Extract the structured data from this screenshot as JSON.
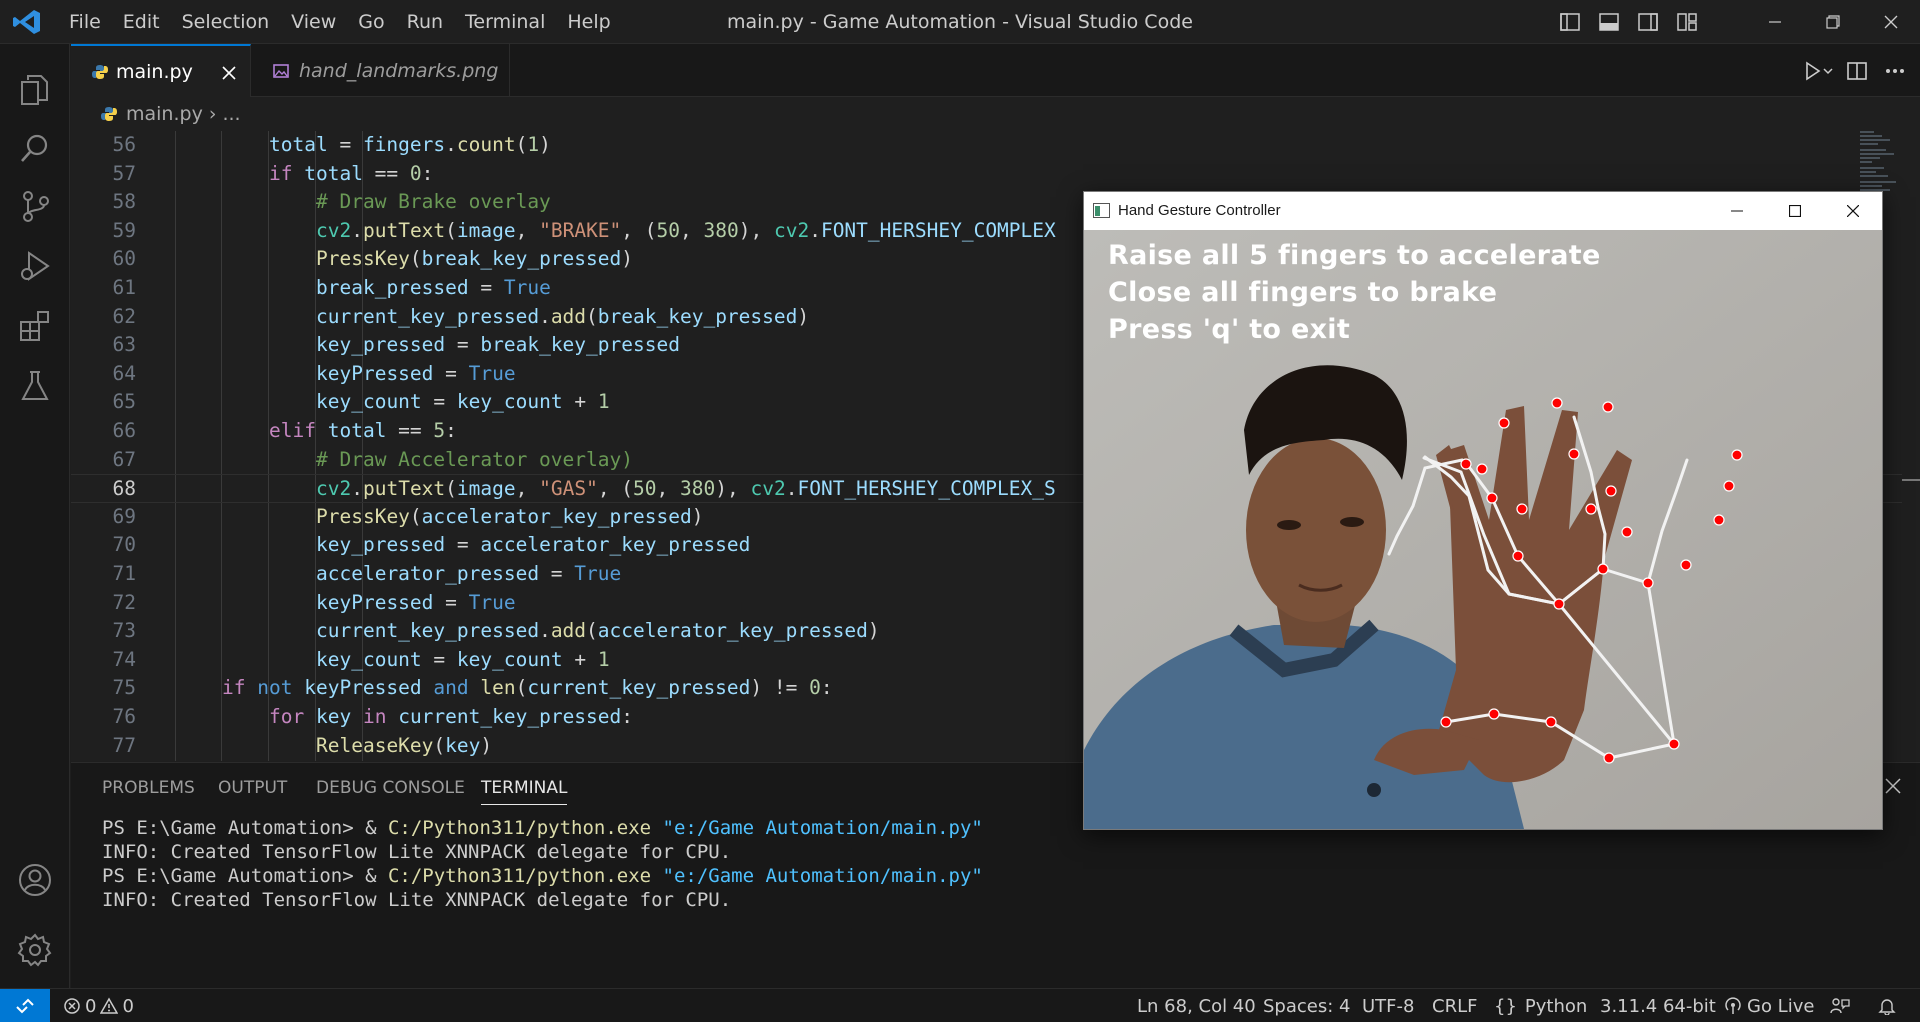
{
  "window": {
    "title": "main.py - Game Automation - Visual Studio Code",
    "menu": [
      "File",
      "Edit",
      "Selection",
      "View",
      "Go",
      "Run",
      "Terminal",
      "Help"
    ]
  },
  "tabs": [
    {
      "label": "main.py",
      "active": true,
      "icon": "python-icon"
    },
    {
      "label": "hand_landmarks.png",
      "active": false,
      "icon": "image-icon"
    }
  ],
  "breadcrumb": {
    "file": "main.py",
    "rest": "..."
  },
  "editor": {
    "current_line": 68,
    "lines": [
      {
        "n": "56",
        "indent": 2,
        "code": [
          [
            "var",
            "total"
          ],
          [
            "op",
            " = "
          ],
          [
            "var",
            "fingers"
          ],
          [
            "op",
            "."
          ],
          [
            "fn",
            "count"
          ],
          [
            "op",
            "("
          ],
          [
            "num",
            "1"
          ],
          [
            "op",
            ")"
          ]
        ]
      },
      {
        "n": "57",
        "indent": 2,
        "code": [
          [
            "kw",
            "if"
          ],
          [
            "op",
            " "
          ],
          [
            "var",
            "total"
          ],
          [
            "op",
            " == "
          ],
          [
            "num",
            "0"
          ],
          [
            "op",
            ":"
          ]
        ]
      },
      {
        "n": "58",
        "indent": 3,
        "code": [
          [
            "cm",
            "# Draw Brake overlay"
          ]
        ]
      },
      {
        "n": "59",
        "indent": 3,
        "code": [
          [
            "cls",
            "cv2"
          ],
          [
            "op",
            "."
          ],
          [
            "fn",
            "putText"
          ],
          [
            "op",
            "("
          ],
          [
            "var",
            "image"
          ],
          [
            "op",
            ", "
          ],
          [
            "str",
            "\"BRAKE\""
          ],
          [
            "op",
            ", ("
          ],
          [
            "num",
            "50"
          ],
          [
            "op",
            ", "
          ],
          [
            "num",
            "380"
          ],
          [
            "op",
            "), "
          ],
          [
            "cls",
            "cv2"
          ],
          [
            "op",
            "."
          ],
          [
            "var",
            "FONT_HERSHEY_COMPLEX"
          ]
        ]
      },
      {
        "n": "60",
        "indent": 3,
        "code": [
          [
            "fn",
            "PressKey"
          ],
          [
            "op",
            "("
          ],
          [
            "var",
            "break_key_pressed"
          ],
          [
            "op",
            ")"
          ]
        ]
      },
      {
        "n": "61",
        "indent": 3,
        "code": [
          [
            "var",
            "break_pressed"
          ],
          [
            "op",
            " = "
          ],
          [
            "kwb",
            "True"
          ]
        ]
      },
      {
        "n": "62",
        "indent": 3,
        "code": [
          [
            "var",
            "current_key_pressed"
          ],
          [
            "op",
            "."
          ],
          [
            "fn",
            "add"
          ],
          [
            "op",
            "("
          ],
          [
            "var",
            "break_key_pressed"
          ],
          [
            "op",
            ")"
          ]
        ]
      },
      {
        "n": "63",
        "indent": 3,
        "code": [
          [
            "var",
            "key_pressed"
          ],
          [
            "op",
            " = "
          ],
          [
            "var",
            "break_key_pressed"
          ]
        ]
      },
      {
        "n": "64",
        "indent": 3,
        "code": [
          [
            "var",
            "keyPressed"
          ],
          [
            "op",
            " = "
          ],
          [
            "kwb",
            "True"
          ]
        ]
      },
      {
        "n": "65",
        "indent": 3,
        "code": [
          [
            "var",
            "key_count"
          ],
          [
            "op",
            " = "
          ],
          [
            "var",
            "key_count"
          ],
          [
            "op",
            " + "
          ],
          [
            "num",
            "1"
          ]
        ]
      },
      {
        "n": "66",
        "indent": 2,
        "code": [
          [
            "kw",
            "elif"
          ],
          [
            "op",
            " "
          ],
          [
            "var",
            "total"
          ],
          [
            "op",
            " == "
          ],
          [
            "num",
            "5"
          ],
          [
            "op",
            ":"
          ]
        ]
      },
      {
        "n": "67",
        "indent": 3,
        "code": [
          [
            "cm",
            "# Draw Accelerator overlay)"
          ]
        ]
      },
      {
        "n": "68",
        "indent": 3,
        "code": [
          [
            "cls",
            "cv2"
          ],
          [
            "op",
            "."
          ],
          [
            "fn",
            "putText"
          ],
          [
            "op",
            "("
          ],
          [
            "var",
            "image"
          ],
          [
            "op",
            ", "
          ],
          [
            "str",
            "\"GAS\""
          ],
          [
            "op",
            ", ("
          ],
          [
            "num",
            "50"
          ],
          [
            "op",
            ", "
          ],
          [
            "num",
            "380"
          ],
          [
            "op",
            "), "
          ],
          [
            "cls",
            "cv2"
          ],
          [
            "op",
            "."
          ],
          [
            "var",
            "FONT_HERSHEY_COMPLEX_S"
          ]
        ]
      },
      {
        "n": "69",
        "indent": 3,
        "code": [
          [
            "fn",
            "PressKey"
          ],
          [
            "op",
            "("
          ],
          [
            "var",
            "accelerator_key_pressed"
          ],
          [
            "op",
            ")"
          ]
        ]
      },
      {
        "n": "70",
        "indent": 3,
        "code": [
          [
            "var",
            "key_pressed"
          ],
          [
            "op",
            " = "
          ],
          [
            "var",
            "accelerator_key_pressed"
          ]
        ]
      },
      {
        "n": "71",
        "indent": 3,
        "code": [
          [
            "var",
            "accelerator_pressed"
          ],
          [
            "op",
            " = "
          ],
          [
            "kwb",
            "True"
          ]
        ]
      },
      {
        "n": "72",
        "indent": 3,
        "code": [
          [
            "var",
            "keyPressed"
          ],
          [
            "op",
            " = "
          ],
          [
            "kwb",
            "True"
          ]
        ]
      },
      {
        "n": "73",
        "indent": 3,
        "code": [
          [
            "var",
            "current_key_pressed"
          ],
          [
            "op",
            "."
          ],
          [
            "fn",
            "add"
          ],
          [
            "op",
            "("
          ],
          [
            "var",
            "accelerator_key_pressed"
          ],
          [
            "op",
            ")"
          ]
        ]
      },
      {
        "n": "74",
        "indent": 3,
        "code": [
          [
            "var",
            "key_count"
          ],
          [
            "op",
            " = "
          ],
          [
            "var",
            "key_count"
          ],
          [
            "op",
            " + "
          ],
          [
            "num",
            "1"
          ]
        ]
      },
      {
        "n": "75",
        "indent": 1,
        "code": [
          [
            "kw",
            "if"
          ],
          [
            "op",
            " "
          ],
          [
            "kwb",
            "not"
          ],
          [
            "op",
            " "
          ],
          [
            "var",
            "keyPressed"
          ],
          [
            "op",
            " "
          ],
          [
            "kwb",
            "and"
          ],
          [
            "op",
            " "
          ],
          [
            "fn",
            "len"
          ],
          [
            "op",
            "("
          ],
          [
            "var",
            "current_key_pressed"
          ],
          [
            "op",
            ") != "
          ],
          [
            "num",
            "0"
          ],
          [
            "op",
            ":"
          ]
        ]
      },
      {
        "n": "76",
        "indent": 2,
        "code": [
          [
            "kw",
            "for"
          ],
          [
            "op",
            " "
          ],
          [
            "var",
            "key"
          ],
          [
            "op",
            " "
          ],
          [
            "kw",
            "in"
          ],
          [
            "op",
            " "
          ],
          [
            "var",
            "current_key_pressed"
          ],
          [
            "op",
            ":"
          ]
        ]
      },
      {
        "n": "77",
        "indent": 3,
        "code": [
          [
            "fn",
            "ReleaseKey"
          ],
          [
            "op",
            "("
          ],
          [
            "var",
            "key"
          ],
          [
            "op",
            ")"
          ]
        ]
      }
    ]
  },
  "panel": {
    "tabs": [
      "PROBLEMS",
      "OUTPUT",
      "DEBUG CONSOLE",
      "TERMINAL"
    ],
    "active_tab": "TERMINAL",
    "terminal": [
      {
        "prompt": "PS E:\\Game Automation> & ",
        "exe": "C:/Python311/python.exe",
        "arg": " \"e:/Game Automation/main.py\""
      },
      {
        "text": "INFO: Created TensorFlow Lite XNNPACK delegate for CPU."
      },
      {
        "prompt": "PS E:\\Game Automation> & ",
        "exe": "C:/Python311/python.exe",
        "arg": " \"e:/Game Automation/main.py\""
      },
      {
        "text": "INFO: Created TensorFlow Lite XNNPACK delegate for CPU."
      }
    ]
  },
  "statusbar": {
    "errors": "0",
    "warnings": "0",
    "position": "Ln 68, Col 40",
    "spaces": "Spaces: 4",
    "encoding": "UTF-8",
    "eol": "CRLF",
    "language": "Python",
    "interpreter": "3.11.4 64-bit",
    "golive": "Go Live"
  },
  "gesture_window": {
    "title": "Hand Gesture Controller",
    "overlay": [
      "Raise all 5 fingers to accelerate",
      "Close all fingers to brake",
      "Press 'q' to exit"
    ]
  },
  "colors": {
    "accent": "#0078d4",
    "landmark": "#ff0000",
    "connection": "#ffffff"
  }
}
